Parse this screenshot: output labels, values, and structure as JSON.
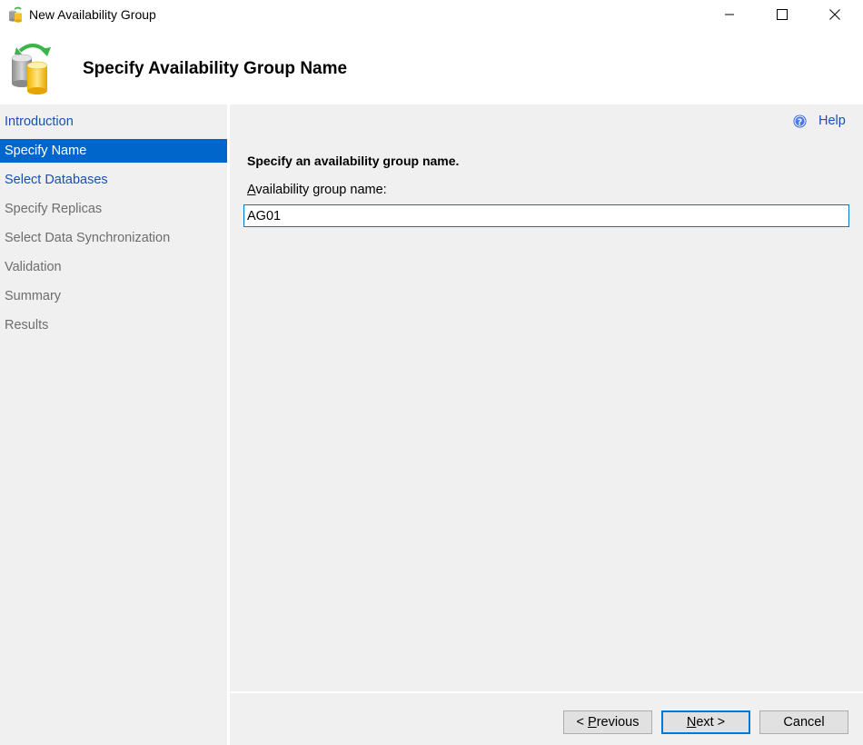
{
  "window": {
    "title": "New Availability Group",
    "controls": {
      "minimize_icon": "minimize-icon",
      "maximize_icon": "maximize-icon",
      "close_icon": "close-icon"
    }
  },
  "header": {
    "title": "Specify Availability Group Name",
    "icon": "availability-group-databases-icon"
  },
  "sidebar": {
    "items": [
      {
        "label": "Introduction",
        "state": "link"
      },
      {
        "label": "Specify Name",
        "state": "active"
      },
      {
        "label": "Select Databases",
        "state": "link"
      },
      {
        "label": "Specify Replicas",
        "state": "disabled"
      },
      {
        "label": "Select Data Synchronization",
        "state": "disabled"
      },
      {
        "label": "Validation",
        "state": "disabled"
      },
      {
        "label": "Summary",
        "state": "disabled"
      },
      {
        "label": "Results",
        "state": "disabled"
      }
    ]
  },
  "content": {
    "help_label": "Help",
    "section_title": "Specify an availability group name.",
    "field_label_mnemonic": "A",
    "field_label_rest": "vailability group name:",
    "field_value": "AG01"
  },
  "footer": {
    "previous_prefix": "< ",
    "previous_mnemonic": "P",
    "previous_rest": "revious",
    "next_mnemonic": "N",
    "next_rest": "ext >",
    "cancel_label": "Cancel"
  },
  "colors": {
    "accent": "#0066cc",
    "link": "#1a4fb5",
    "focus_border": "#0078d7",
    "panel_bg": "#f0f0f0"
  }
}
